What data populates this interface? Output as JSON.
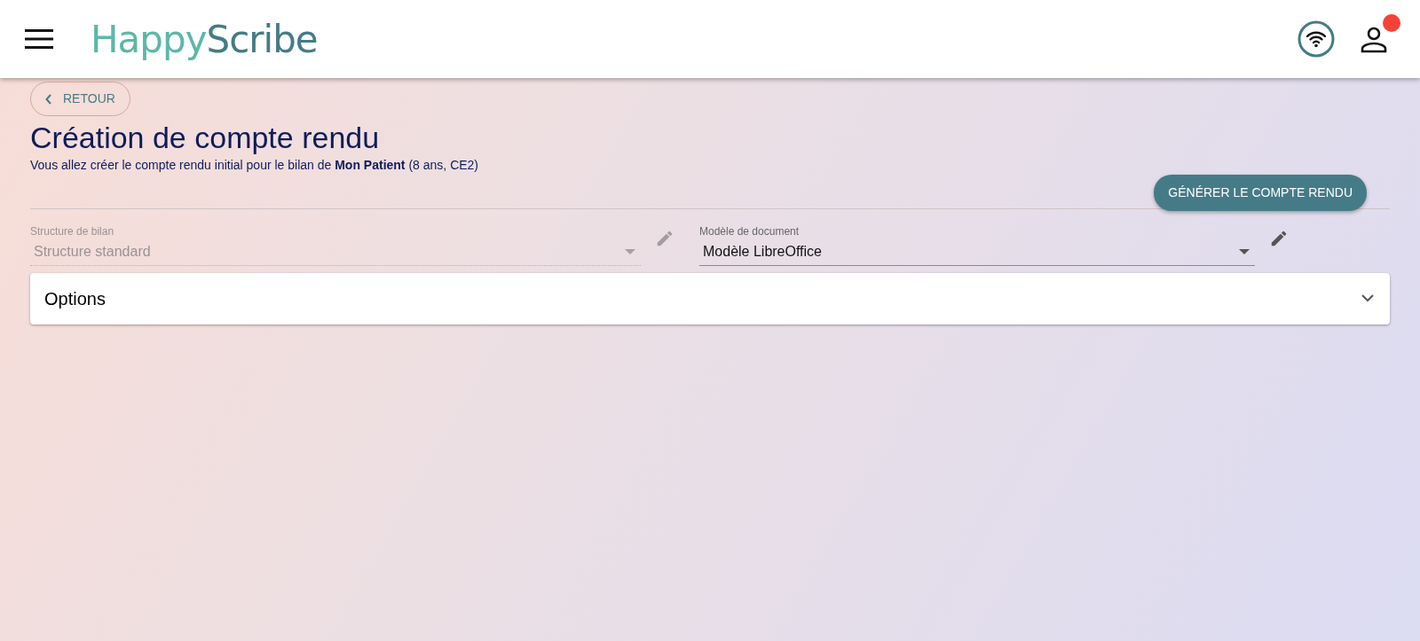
{
  "header": {
    "logo_first": "Happy",
    "logo_second": "Scribe",
    "notification": true
  },
  "back_button": "RETOUR",
  "title": "Création de compte rendu",
  "subtitle": "Vous allez créer le compte rendu initial pour le bilan de **Mon Patient** (8 ans, CE2)",
  "generate_button": "GÉNÉRER LE COMPTE RENDU",
  "fields": [
    {
      "label": "Structure de bilan",
      "value": "Structure standard",
      "disabled": true
    },
    {
      "label": "Modèle de document",
      "value": "Modèle LibreOffice",
      "disabled": false
    }
  ],
  "options_panel": {
    "title": "Options",
    "expanded": false
  }
}
